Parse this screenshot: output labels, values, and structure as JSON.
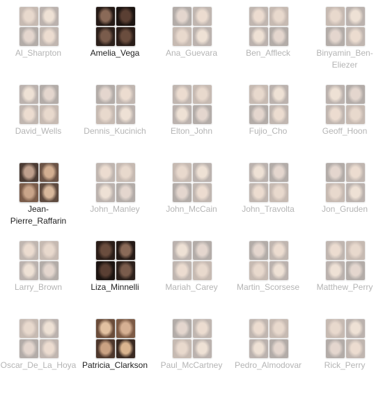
{
  "window": {
    "title": ""
  },
  "folders": [
    {
      "name": "Al_Sharpton",
      "state": "dim",
      "tone": "mixed"
    },
    {
      "name": "Amelia_Vega",
      "state": "sel",
      "tone": "dark"
    },
    {
      "name": "Ana_Guevara",
      "state": "dim",
      "tone": "mixed"
    },
    {
      "name": "Ben_Affleck",
      "state": "dim",
      "tone": "mixed"
    },
    {
      "name": "Binyamin_Ben-Eliezer",
      "state": "dim",
      "tone": "mixed"
    },
    {
      "name": "David_Wells",
      "state": "dim",
      "tone": "mixed"
    },
    {
      "name": "Dennis_Kucinich",
      "state": "dim",
      "tone": "mixed"
    },
    {
      "name": "Elton_John",
      "state": "dim",
      "tone": "mixed"
    },
    {
      "name": "Fujio_Cho",
      "state": "dim",
      "tone": "mixed"
    },
    {
      "name": "Geoff_Hoon",
      "state": "dim",
      "tone": "mixed"
    },
    {
      "name": "Jean-Pierre_Raffarin",
      "state": "sel",
      "tone": "mixed"
    },
    {
      "name": "John_Manley",
      "state": "dim",
      "tone": "mixed"
    },
    {
      "name": "John_McCain",
      "state": "dim",
      "tone": "mixed"
    },
    {
      "name": "John_Travolta",
      "state": "dim",
      "tone": "mixed"
    },
    {
      "name": "Jon_Gruden",
      "state": "dim",
      "tone": "mixed"
    },
    {
      "name": "Larry_Brown",
      "state": "dim",
      "tone": "mixed"
    },
    {
      "name": "Liza_Minnelli",
      "state": "sel",
      "tone": "dark"
    },
    {
      "name": "Mariah_Carey",
      "state": "dim",
      "tone": "mixed"
    },
    {
      "name": "Martin_Scorsese",
      "state": "dim",
      "tone": "mixed"
    },
    {
      "name": "Matthew_Perry",
      "state": "dim",
      "tone": "mixed"
    },
    {
      "name": "Oscar_De_La_Hoya",
      "state": "dim",
      "tone": "mixed"
    },
    {
      "name": "Patricia_Clarkson",
      "state": "sel",
      "tone": "warm"
    },
    {
      "name": "Paul_McCartney",
      "state": "dim",
      "tone": "mixed"
    },
    {
      "name": "Pedro_Almodovar",
      "state": "dim",
      "tone": "mixed"
    },
    {
      "name": "Rick_Perry",
      "state": "dim",
      "tone": "mixed"
    }
  ],
  "colors": {
    "label_selected": "#1e1e1e",
    "label_dimmed": "#b4b4b4"
  }
}
